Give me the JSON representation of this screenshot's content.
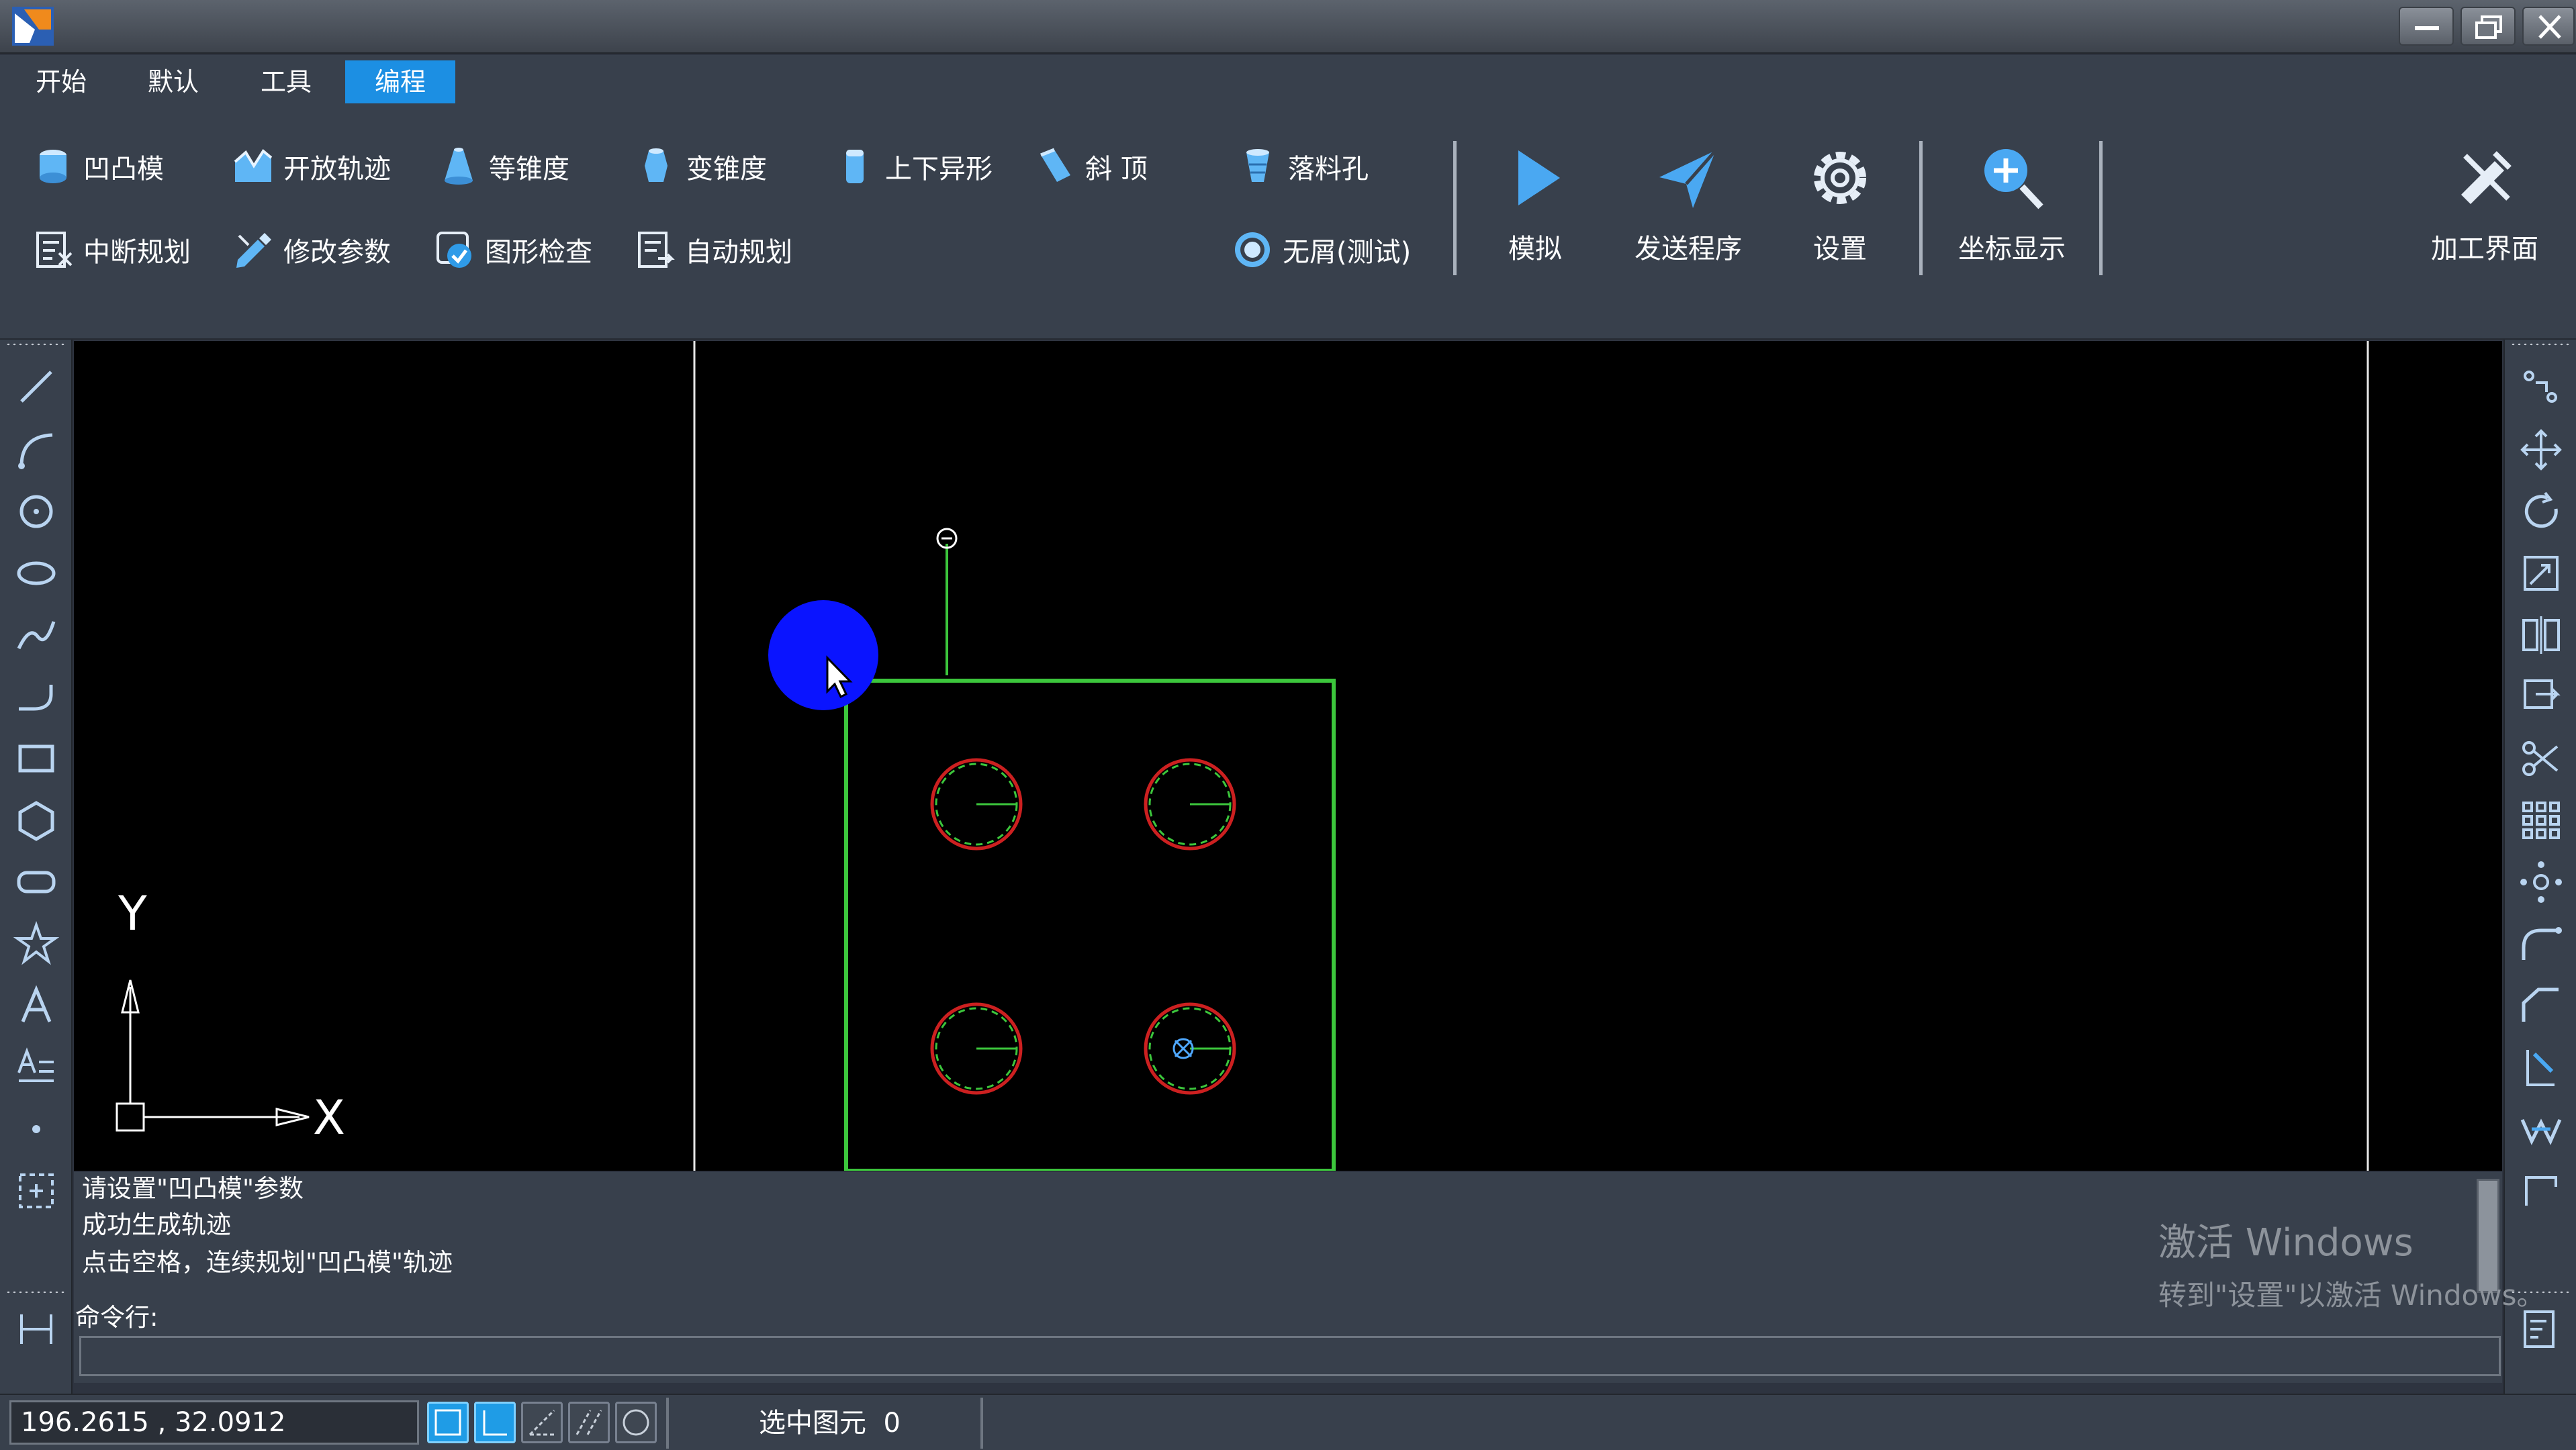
{
  "menu": {
    "tabs": [
      {
        "label": "开始"
      },
      {
        "label": "默认"
      },
      {
        "label": "工具"
      },
      {
        "label": "编程"
      }
    ],
    "active_tab": "编程"
  },
  "ribbon": {
    "row1": [
      {
        "label": "凹凸模",
        "icon": "cylinder-icon"
      },
      {
        "label": "开放轨迹",
        "icon": "open-path-icon"
      },
      {
        "label": "等锥度",
        "icon": "cone-icon"
      },
      {
        "label": "变锥度",
        "icon": "variable-taper-icon"
      },
      {
        "label": "上下异形",
        "icon": "upper-lower-shape-icon"
      },
      {
        "label": "斜 顶",
        "icon": "slanted-top-icon"
      },
      {
        "label": "落料孔",
        "icon": "blanking-hole-icon"
      }
    ],
    "row2": [
      {
        "label": "中断规划",
        "icon": "interrupt-plan-icon"
      },
      {
        "label": "修改参数",
        "icon": "edit-params-icon"
      },
      {
        "label": "图形检查",
        "icon": "shape-check-icon"
      },
      {
        "label": "自动规划",
        "icon": "auto-plan-icon"
      },
      {
        "label": "无屑(测试)",
        "icon": "no-chip-icon"
      }
    ],
    "big_buttons": [
      {
        "label": "模拟",
        "icon": "play-icon"
      },
      {
        "label": "发送程序",
        "icon": "send-icon"
      },
      {
        "label": "设置",
        "icon": "gear-icon"
      },
      {
        "label": "坐标显示",
        "icon": "zoom-in-icon"
      },
      {
        "label": "加工界面",
        "icon": "machining-icon"
      }
    ]
  },
  "canvas": {
    "axis_x_label": "X",
    "axis_y_label": "Y"
  },
  "console": {
    "lines": [
      "请设置\"凹凸模\"参数",
      "成功生成轨迹",
      "点击空格，连续规划\"凹凸模\"轨迹"
    ],
    "command_label": "命令行:",
    "command_value": "",
    "watermark_line1": "激活 Windows",
    "watermark_line2": "转到\"设置\"以激活 Windows。"
  },
  "status": {
    "coordinates": "196.2615 , 32.0912",
    "selected_label": "选中图元",
    "selected_count": "0"
  },
  "colors": {
    "accent_tab": "#1c8fe3",
    "panel_bg": "#38404c",
    "canvas_bg": "#000000",
    "contour_green": "#3cc63c",
    "hole_red": "#cc2020",
    "cursor_highlight": "#0a14ff"
  }
}
